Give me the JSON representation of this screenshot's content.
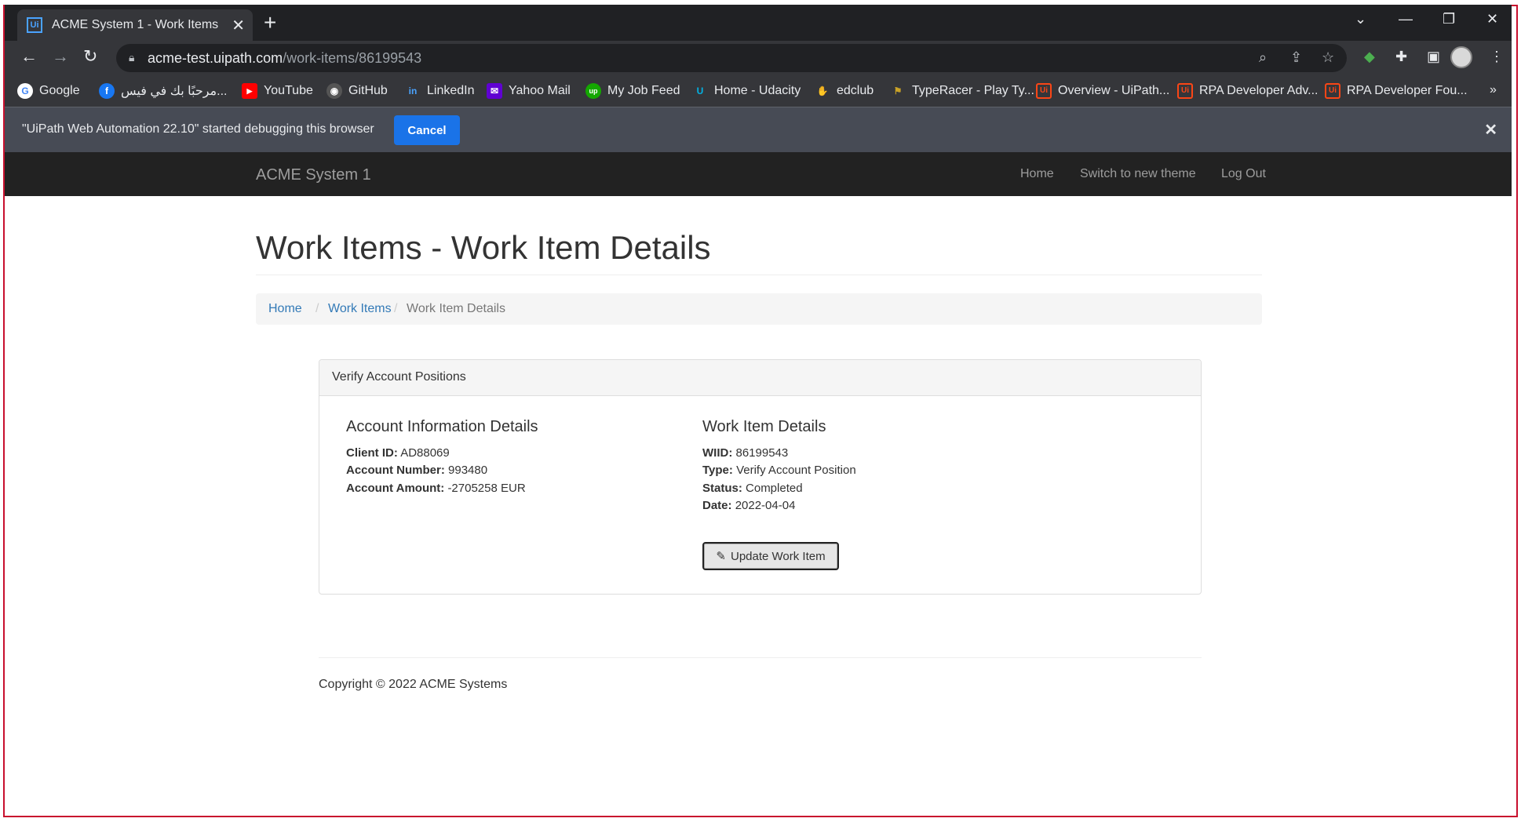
{
  "browser": {
    "tab_title": "ACME System 1 - Work Items",
    "tab_favicon": "Ui",
    "url_host": "acme-test.uipath.com",
    "url_path": "/work-items/86199543",
    "bookmarks": [
      {
        "label": "Google",
        "icon": "google-icon",
        "color": "#4285f4",
        "glyph": "G"
      },
      {
        "label": "مرحبًا بك في فيس...",
        "icon": "facebook-icon",
        "color": "#1877f2",
        "glyph": "f"
      },
      {
        "label": "YouTube",
        "icon": "youtube-icon",
        "color": "#ff0000",
        "glyph": "▶"
      },
      {
        "label": "GitHub",
        "icon": "github-icon",
        "color": "#555555",
        "glyph": "◉"
      },
      {
        "label": "LinkedIn",
        "icon": "linkedin-icon",
        "color": "#0a66c2",
        "glyph": "in"
      },
      {
        "label": "Yahoo Mail",
        "icon": "yahoo-mail-icon",
        "color": "#6001d2",
        "glyph": "✉"
      },
      {
        "label": "My Job Feed",
        "icon": "upwork-icon",
        "color": "#14a800",
        "glyph": "up"
      },
      {
        "label": "Home - Udacity",
        "icon": "udacity-icon",
        "color": "#02b3e4",
        "glyph": "U"
      },
      {
        "label": "edclub",
        "icon": "edclub-icon",
        "color": "#f28c28",
        "glyph": "✋"
      },
      {
        "label": "TypeRacer - Play Ty...",
        "icon": "typeracer-icon",
        "color": "#c9a227",
        "glyph": "⚑"
      },
      {
        "label": "Overview - UiPath...",
        "icon": "uipath-icon",
        "color": "#fa4616",
        "glyph": "Ui"
      },
      {
        "label": "RPA Developer Adv...",
        "icon": "uipath-icon",
        "color": "#fa4616",
        "glyph": "Ui"
      },
      {
        "label": "RPA Developer Fou...",
        "icon": "uipath-icon",
        "color": "#fa4616",
        "glyph": "Ui"
      }
    ],
    "infobar_message": "\"UiPath Web Automation 22.10\" started debugging this browser",
    "infobar_cancel": "Cancel"
  },
  "app": {
    "brand": "ACME System 1",
    "nav": [
      "Home",
      "Switch to new theme",
      "Log Out"
    ]
  },
  "page": {
    "title": "Work Items - Work Item Details",
    "breadcrumb": {
      "home": "Home",
      "sep": "/",
      "work_items": "Work Items",
      "current": "Work Item Details"
    },
    "panel_title": "Verify Account Positions",
    "account": {
      "heading": "Account Information Details",
      "client_id_label": "Client ID:",
      "client_id": "AD88069",
      "account_number_label": "Account Number:",
      "account_number": "993480",
      "account_amount_label": "Account Amount:",
      "account_amount": "-2705258 EUR"
    },
    "work_item": {
      "heading": "Work Item Details",
      "wiid_label": "WIID:",
      "wiid": "86199543",
      "type_label": "Type:",
      "type": "Verify Account Position",
      "status_label": "Status:",
      "status": "Completed",
      "date_label": "Date:",
      "date": "2022-04-04"
    },
    "update_button": "Update Work Item",
    "footer": "Copyright © 2022 ACME Systems"
  }
}
